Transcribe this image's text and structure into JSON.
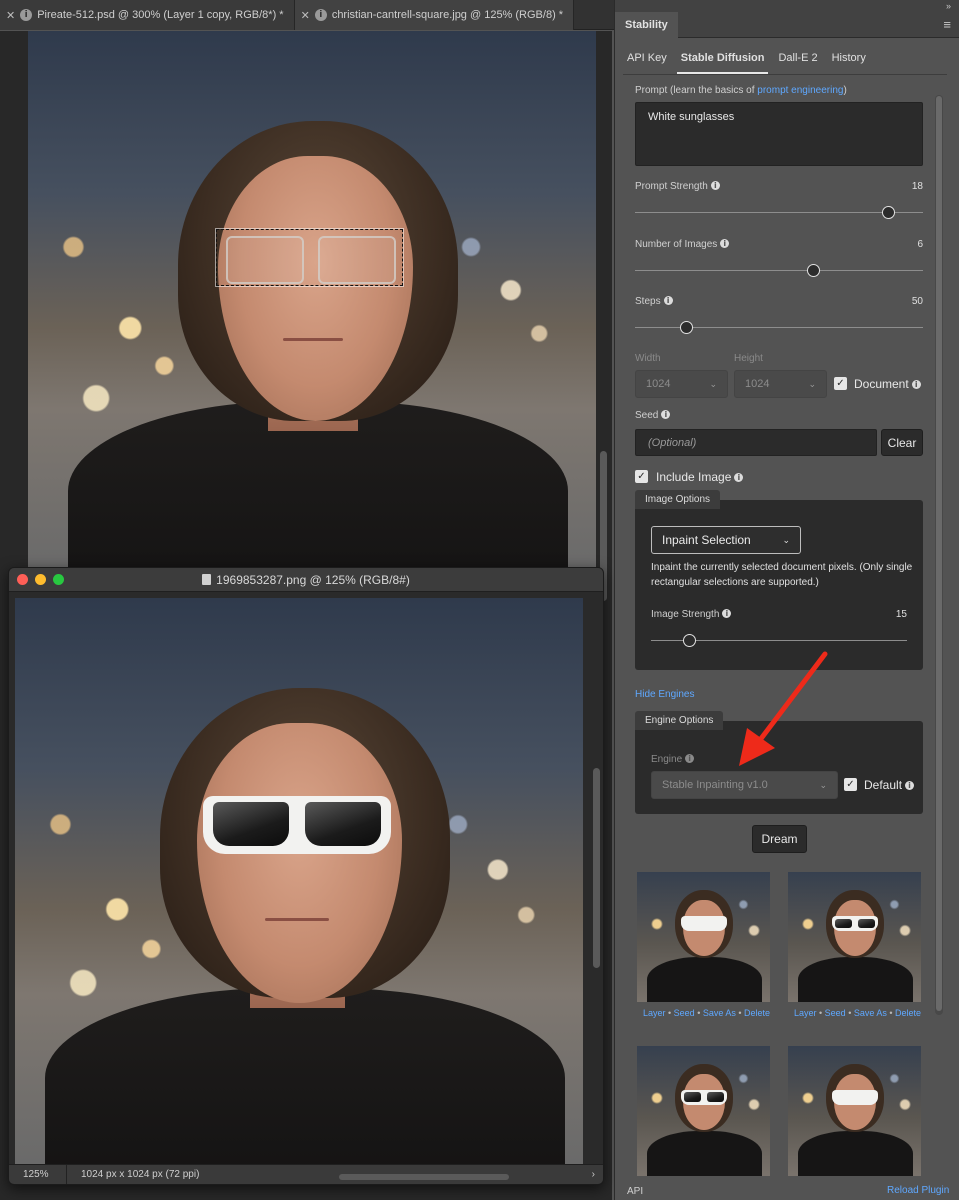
{
  "doc_tabs": [
    {
      "label": "Pireate-512.psd @ 300% (Layer 1 copy, RGB/8*) *"
    },
    {
      "label": "christian-cantrell-square.jpg @ 125% (RGB/8) *"
    }
  ],
  "float_window": {
    "title": "1969853287.png @ 125% (RGB/8#)",
    "zoom": "125%",
    "dimensions": "1024 px x 1024 px (72 ppi)",
    "status_arrow": "›"
  },
  "panel": {
    "collapse_glyph": "»",
    "tab": "Stability",
    "menu_icon": "≡",
    "subtabs": [
      "API Key",
      "Stable Diffusion",
      "Dall-E 2",
      "History"
    ],
    "prompt_label_pre": "Prompt (learn the basics of ",
    "prompt_link": "prompt engineering",
    "prompt_label_post": ")",
    "prompt_value": "White sunglasses",
    "prompt_strength_label": "Prompt Strength",
    "prompt_strength_value": "18",
    "prompt_strength_fraction": 0.88,
    "num_images_label": "Number of Images",
    "num_images_value": "6",
    "num_images_fraction": 0.62,
    "steps_label": "Steps",
    "steps_value": "50",
    "steps_fraction": 0.18,
    "width_label": "Width",
    "width_value": "1024",
    "height_label": "Height",
    "height_value": "1024",
    "document_label": "Document",
    "seed_label": "Seed",
    "seed_placeholder": "(Optional)",
    "clear_label": "Clear",
    "include_image_label": "Include Image",
    "image_options_tab": "Image Options",
    "inpaint_select": "Inpaint Selection",
    "inpaint_desc": "Inpaint the currently selected document pixels. (Only single rectangular selections are supported.)",
    "image_strength_label": "Image Strength",
    "image_strength_value": "15",
    "image_strength_fraction": 0.15,
    "hide_engines_label": "Hide Engines",
    "engine_options_tab": "Engine Options",
    "engine_label": "Engine",
    "engine_value": "Stable Inpainting v1.0",
    "default_label": "Default",
    "dream_label": "Dream",
    "thumb_actions": [
      "Layer",
      "Seed",
      "Save As",
      "Delete"
    ],
    "footer_left": "API",
    "footer_right": "Reload Plugin",
    "check_glyph": "✓",
    "info_glyph": "i",
    "chevron_glyph": "⌄"
  },
  "colors": {
    "link": "#5fa8ff",
    "panel_bg": "#535353",
    "arrow": "#ee2a1a"
  }
}
